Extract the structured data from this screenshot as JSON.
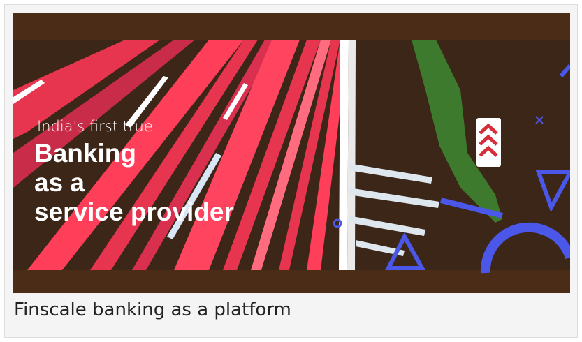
{
  "banner": {
    "tagline": "India's first true",
    "headline_lines": [
      "Banking",
      "as a",
      "service provider"
    ]
  },
  "caption": "Finscale banking as a platform",
  "colors": {
    "banner_background": "#4a2c17",
    "light_streak": "#ff3b55",
    "accent_shape": "#4b57e8",
    "card_background": "#f4f4f4"
  },
  "icons": [
    "chevron-sign-icon",
    "triangle-shape-icon",
    "circle-shape-icon",
    "cross-shape-icon"
  ]
}
